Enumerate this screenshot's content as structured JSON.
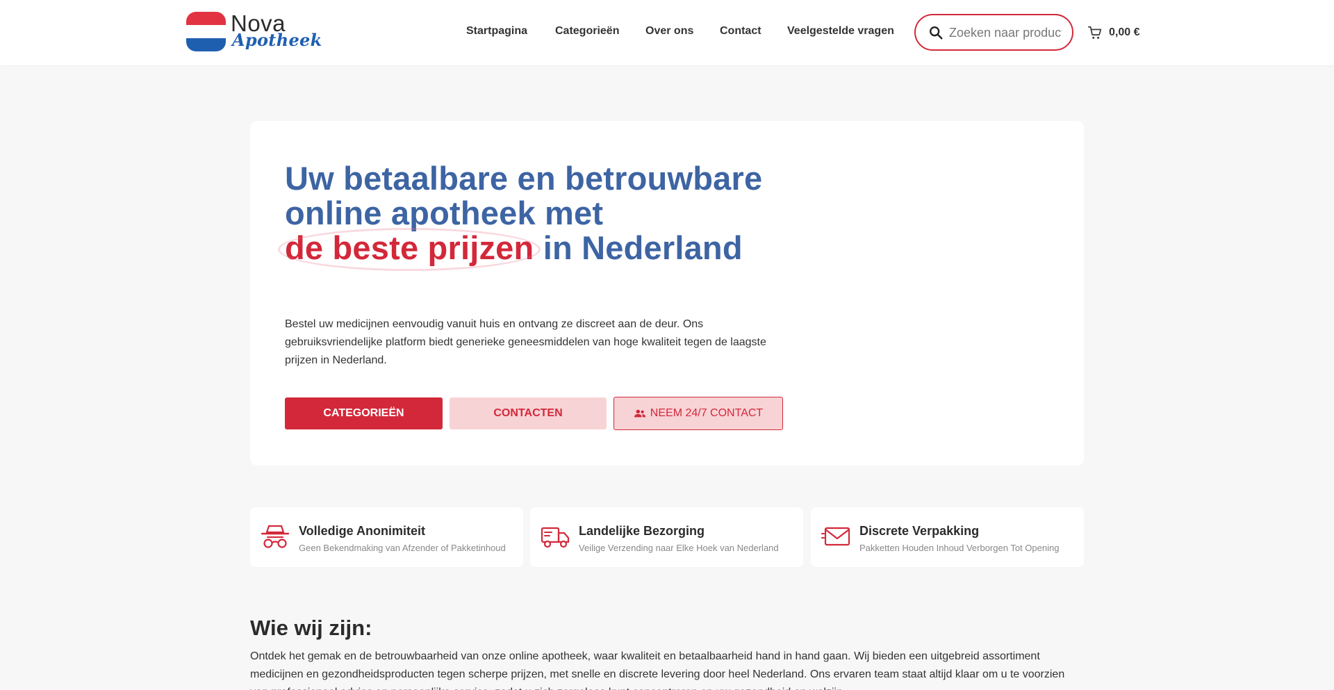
{
  "brand": {
    "name": "Nova",
    "subtitle": "Apotheek",
    "colors": {
      "primary": "#d3283a",
      "blue": "#3d64a3",
      "logo_blue": "#1f5fb0"
    }
  },
  "nav": {
    "items": [
      {
        "label": "Startpagina"
      },
      {
        "label": "Categorieën"
      },
      {
        "label": "Over ons"
      },
      {
        "label": "Contact"
      },
      {
        "label": "Veelgestelde vragen"
      }
    ]
  },
  "search": {
    "placeholder": "Zoeken naar producten...",
    "value": "",
    "icon": "search-icon"
  },
  "cart": {
    "total": "0,00 €",
    "icon": "cart-icon"
  },
  "hero": {
    "title_part1": "Uw betaalbare en betrouwbare online apotheek met",
    "title_highlight": "de beste prijzen",
    "title_part2": "in Nederland",
    "description": "Bestel uw medicijnen eenvoudig vanuit huis en ontvang ze discreet aan de deur. Ons gebruiksvriendelijke platform biedt generieke geneesmiddelen van hoge kwaliteit tegen de laagste prijzen in Nederland.",
    "buttons": {
      "categories": "Categorieën",
      "contact": "Contacten",
      "contact247": "Neem 24/7 contact"
    }
  },
  "features": [
    {
      "icon": "incognito-icon",
      "title": "Volledige Anonimiteit",
      "subtitle": "Geen Bekendmaking van Afzender of Pakketinhoud"
    },
    {
      "icon": "truck-icon",
      "title": "Landelijke Bezorging",
      "subtitle": "Veilige Verzending naar Elke Hoek van Nederland"
    },
    {
      "icon": "envelope-icon",
      "title": "Discrete Verpakking",
      "subtitle": "Pakketten Houden Inhoud Verborgen Tot Opening"
    }
  ],
  "about": {
    "title": "Wie wij zijn:",
    "text": "Ontdek het gemak en de betrouwbaarheid van onze online apotheek, waar kwaliteit en betaalbaarheid hand in hand gaan. Wij bieden een uitgebreid assortiment medicijnen en gezondheidsproducten tegen scherpe prijzen, met snelle en discrete levering door heel Nederland. Ons ervaren team staat altijd klaar om u te voorzien van professioneel advies en persoonlijke service, zodat u zich zorgeloos kunt concentreren op uw gezondheid en welzijn."
  }
}
